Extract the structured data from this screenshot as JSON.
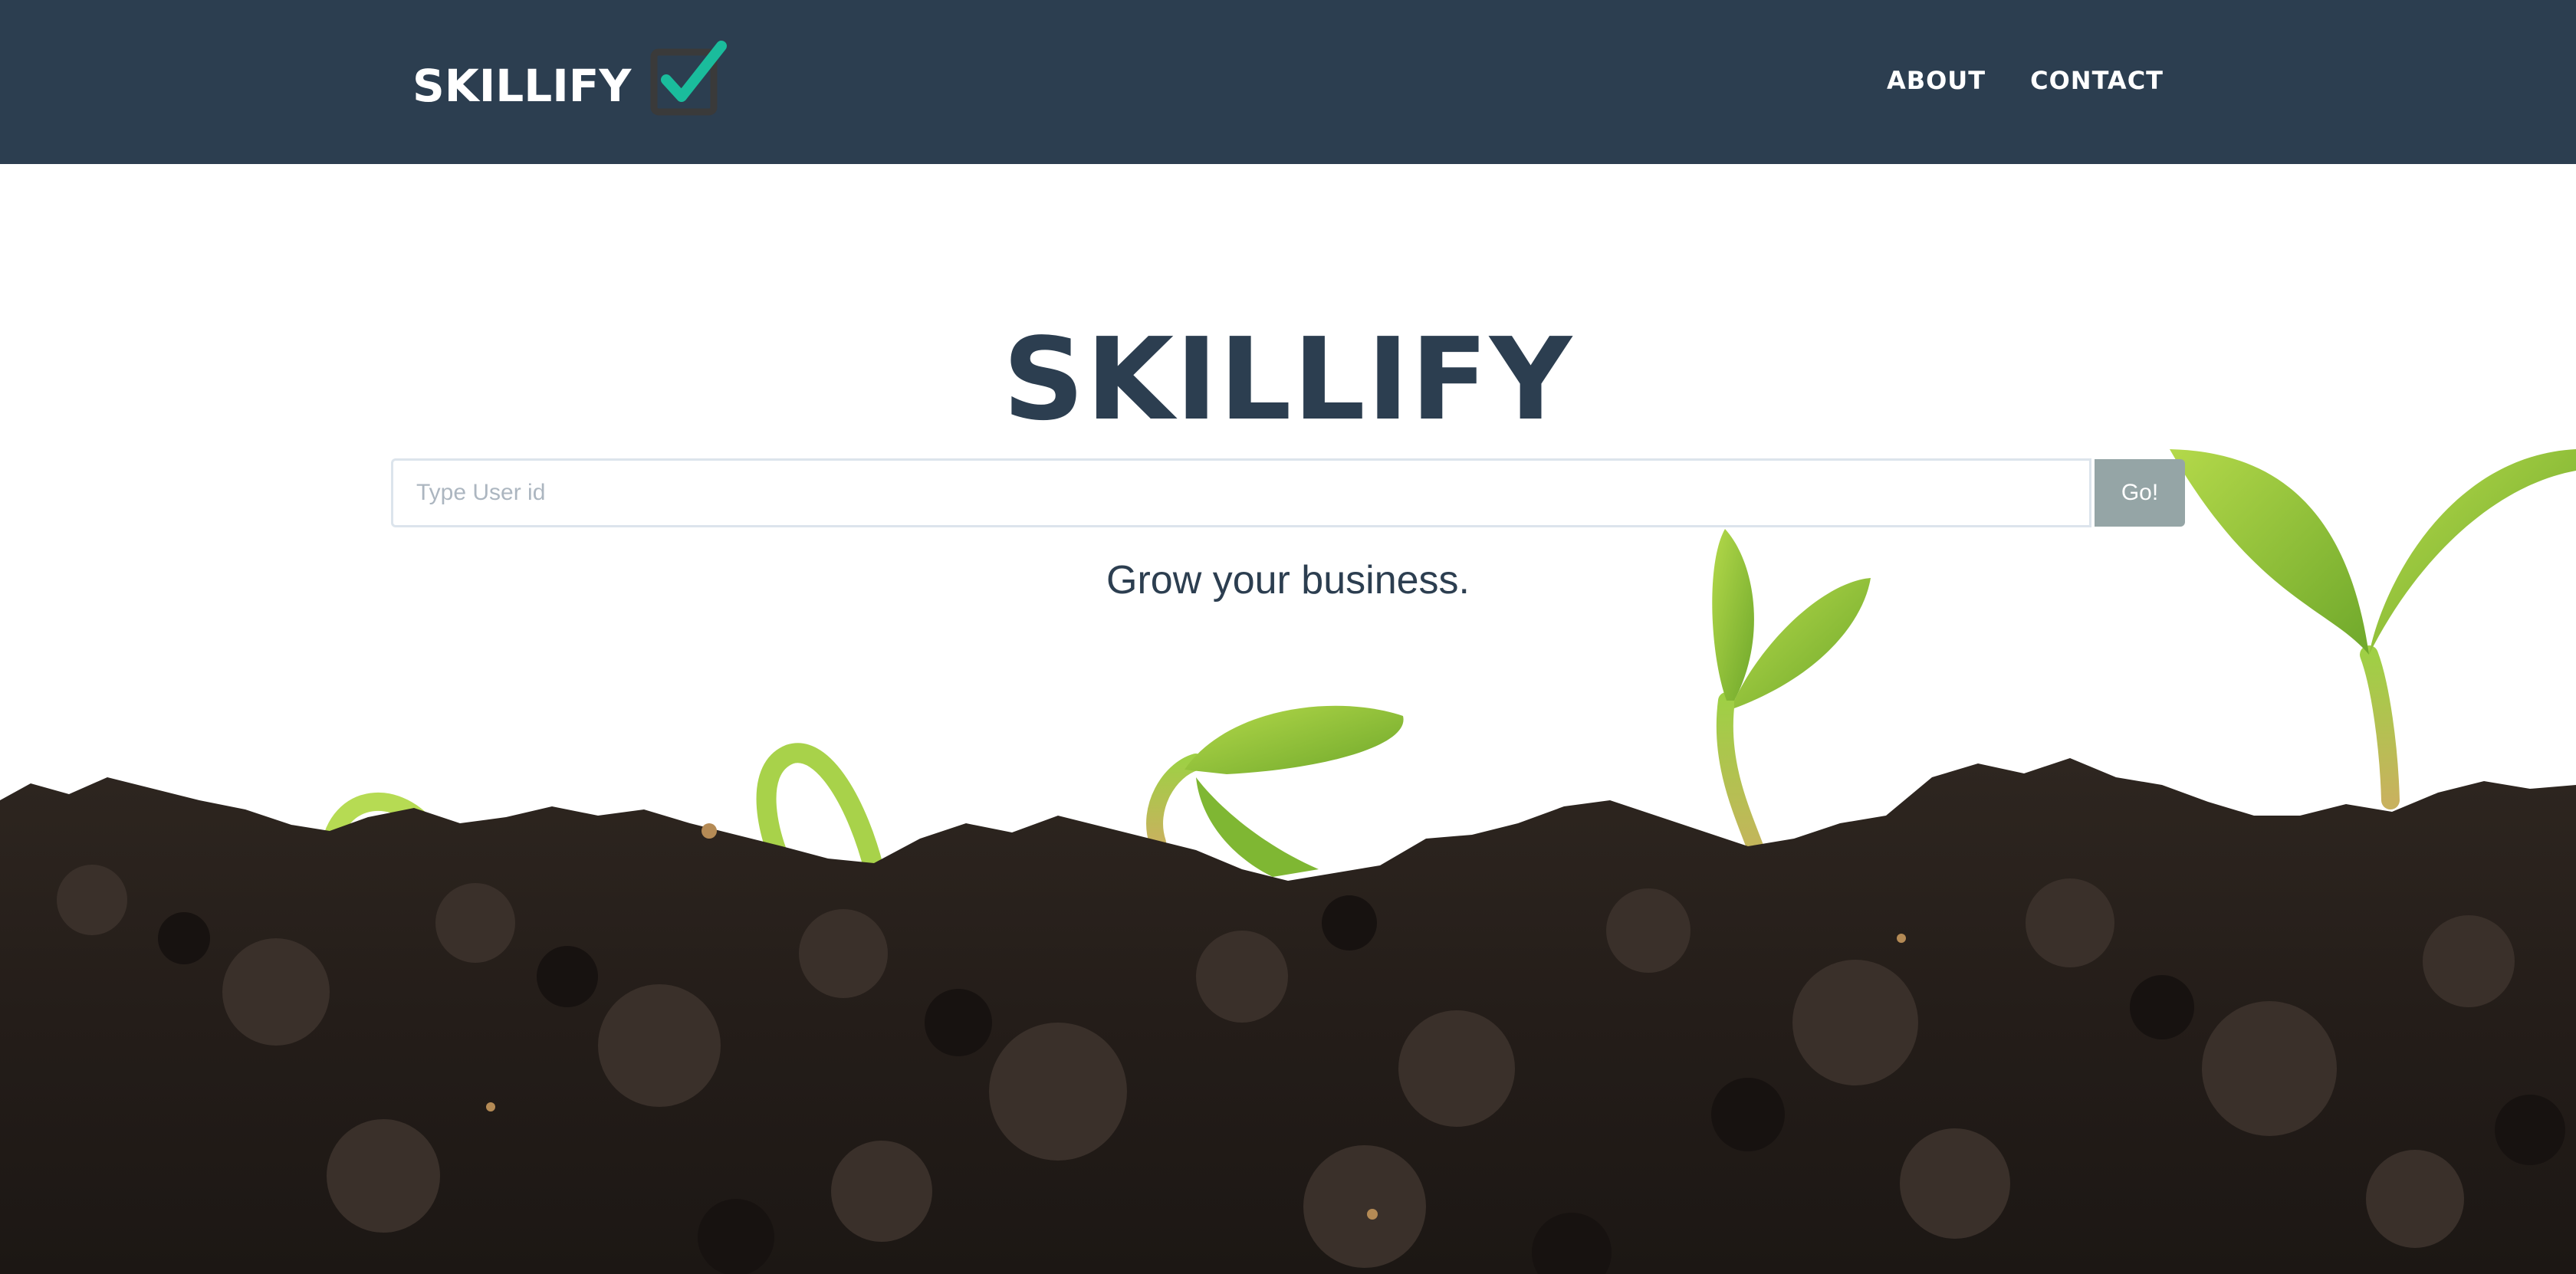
{
  "navbar": {
    "brand": "SKILLIFY",
    "links": [
      "ABOUT",
      "CONTACT"
    ]
  },
  "hero": {
    "title": "SKILLIFY",
    "search": {
      "placeholder": "Type User id",
      "value": "",
      "button_label": "Go!"
    },
    "tagline": "Grow your business."
  },
  "colors": {
    "navbar_bg": "#2c3e50",
    "title_text": "#2c3e50",
    "button_bg": "#95a5a6",
    "logo_check": "#1abc9c",
    "soil": "#2a221d",
    "sprout": "#8cc63f"
  },
  "icons": {
    "logo": "checkbox-check-icon"
  }
}
